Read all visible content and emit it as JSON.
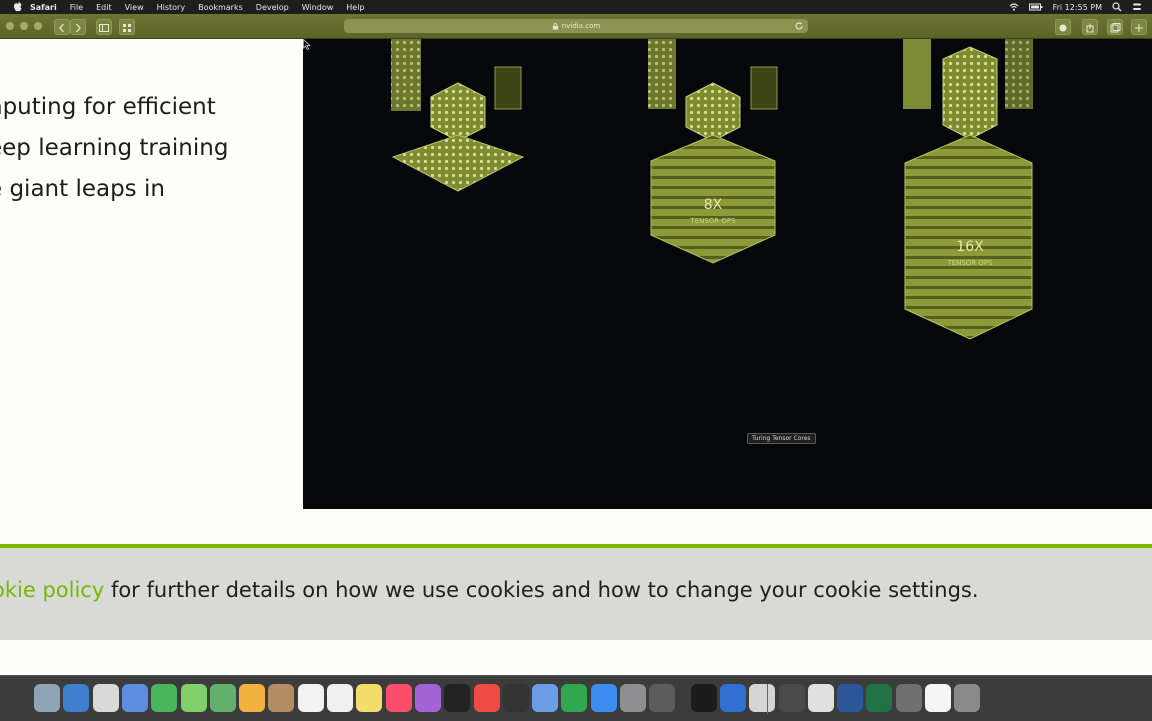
{
  "menubar": {
    "app": "Safari",
    "items": [
      "File",
      "Edit",
      "View",
      "History",
      "Bookmarks",
      "Develop",
      "Window",
      "Help"
    ],
    "clock": "Fri 12:55 PM"
  },
  "toolbar": {
    "url": "nvidia.com"
  },
  "page": {
    "headline": [
      "nputing for efficient",
      "eep learning training",
      "e giant leaps in"
    ]
  },
  "video": {
    "tooltip": "Turing Tensor Cores",
    "labels": {
      "middle_big": "8X",
      "middle_small": "TENSOR OPS",
      "right_big": "16X",
      "right_small": "TENSOR OPS"
    },
    "colors": {
      "cube": "#9aa844",
      "cube_dark": "#5f6b22",
      "background": "#05070a"
    }
  },
  "cookie_banner": {
    "link_text": "okie policy",
    "text": " for further details on how we use cookies and how to change your cookie settings."
  },
  "dock": {
    "icons": [
      "finder-icon",
      "launchpad-icon",
      "safari-icon",
      "mail-icon",
      "facetime-icon",
      "messages-icon",
      "maps-icon",
      "photos-icon",
      "contacts-icon",
      "calendar-icon",
      "reminders-icon",
      "notes-icon",
      "music-icon",
      "podcasts-icon",
      "tv-icon",
      "news-icon",
      "stocks-icon",
      "keynote-icon",
      "numbers-icon",
      "appstore-icon",
      "preferences-icon",
      "screenshot-icon",
      "terminal-icon",
      "xcode-icon",
      "app-icon",
      "app2-icon",
      "app3-icon",
      "word-icon",
      "excel-icon",
      "app4-icon",
      "document-icon",
      "trash-icon"
    ]
  }
}
